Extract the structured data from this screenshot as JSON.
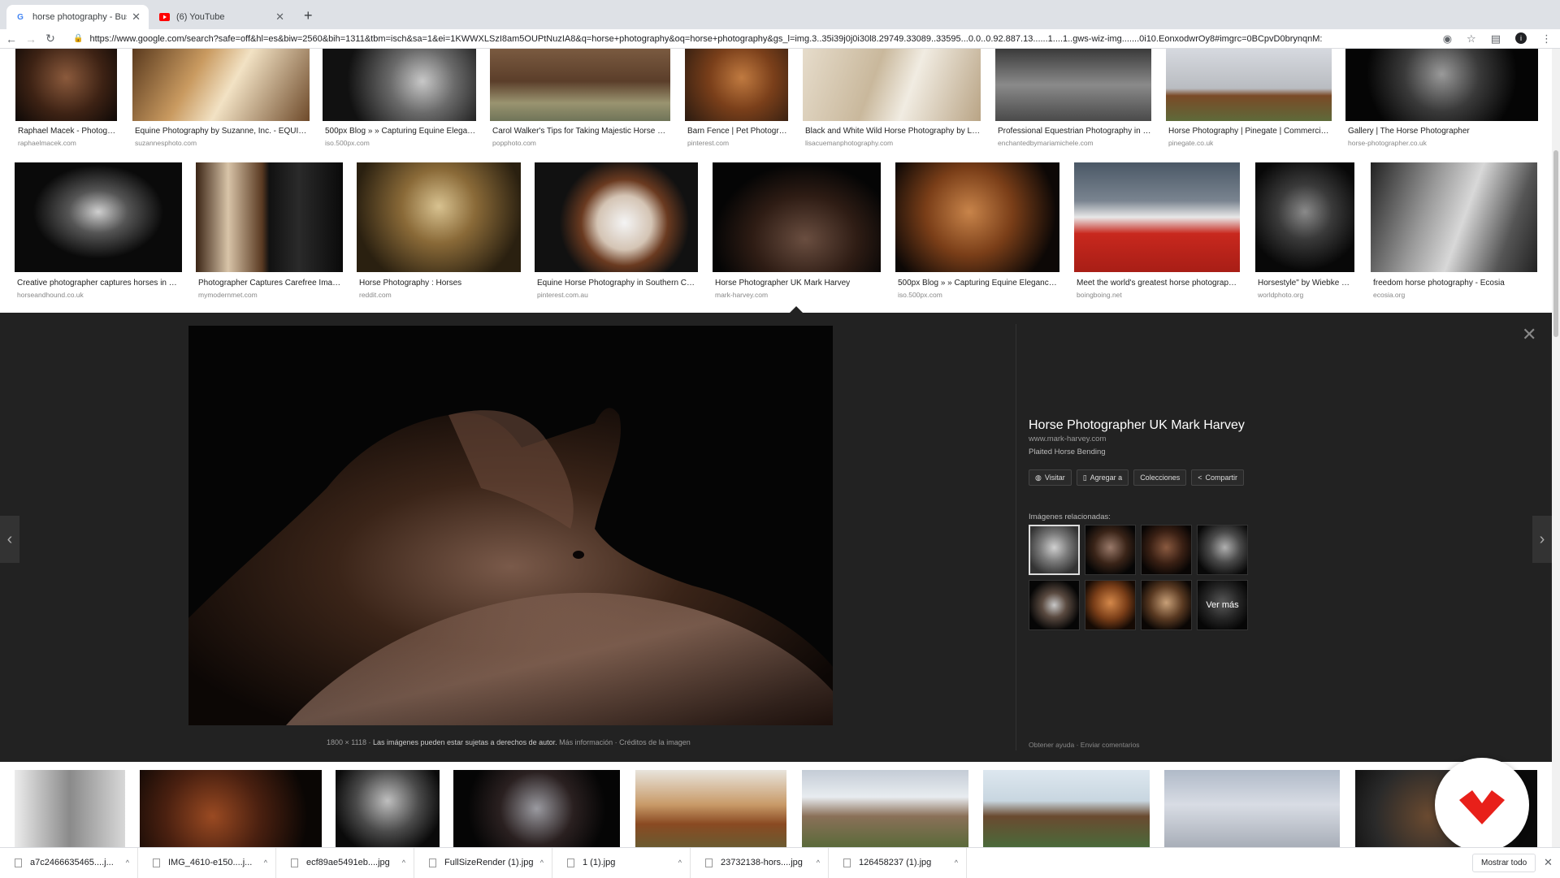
{
  "tabs": [
    {
      "label": "horse photography - Buscar co",
      "icon": "google-icon"
    },
    {
      "label": "(6) YouTube",
      "icon": "youtube-icon"
    }
  ],
  "toolbar": {
    "url": "https://www.google.com/search?safe=off&hl=es&biw=2560&bih=1311&tbm=isch&sa=1&ei=1KWWXLSzI8am5OUPtNuzIA8&q=horse+photography&oq=horse+photography&gs_l=img.3..35i39j0j0i30l8.29749.33089..33595...0.0..0.92.887.13......1....1..gws-wiz-img.......0i10.EonxodwrOy8#imgrc=0BCpvD0brynqnM:"
  },
  "row1": [
    {
      "title": "Raphael Macek - Photogra...",
      "domain": "raphaelmacek.com"
    },
    {
      "title": "Equine Photography by Suzanne, Inc. - EQUIN...",
      "domain": "suzannesphoto.com"
    },
    {
      "title": "500px Blog » » Capturing Equine Eleganc...",
      "domain": "iso.500px.com"
    },
    {
      "title": "Carol Walker's Tips for Taking Majestic Horse Pho...",
      "domain": "popphoto.com"
    },
    {
      "title": "Barn Fence | Pet Photogra...",
      "domain": "pinterest.com"
    },
    {
      "title": "Black and White Wild Horse Photography by Lisa...",
      "domain": "lisacuemanphotography.com"
    },
    {
      "title": "Professional Equestrian Photography in S...",
      "domain": "enchantedbymariamichele.com"
    },
    {
      "title": "Horse Photography | Pinegate | Commercial ...",
      "domain": "pinegate.co.uk"
    },
    {
      "title": "Gallery | The Horse Photographer",
      "domain": "horse-photographer.co.uk"
    }
  ],
  "row2": [
    {
      "title": "Creative photographer captures horses in ne...",
      "domain": "horseandhound.co.uk"
    },
    {
      "title": "Photographer Captures Carefree Image...",
      "domain": "mymodernmet.com"
    },
    {
      "title": "Horse Photography : Horses",
      "domain": "reddit.com"
    },
    {
      "title": "Equine Horse Photography in Southern Calif...",
      "domain": "pinterest.com.au"
    },
    {
      "title": "Horse Photographer UK Mark Harvey",
      "domain": "mark-harvey.com"
    },
    {
      "title": "500px Blog » » Capturing Equine Elegance: ...",
      "domain": "iso.500px.com"
    },
    {
      "title": "Meet the world's greatest horse photographer...",
      "domain": "boingboing.net"
    },
    {
      "title": "Horsestyle\" by Wiebke Ha...",
      "domain": "worldphoto.org"
    },
    {
      "title": "freedom horse photography - Ecosia",
      "domain": "ecosia.org"
    }
  ],
  "preview": {
    "title": "Horse Photographer UK Mark Harvey",
    "domain": "www.mark-harvey.com",
    "subtitle": "Plaited Horse Bending",
    "buttons": [
      "Visitar",
      "Agregar a",
      "Colecciones",
      "Compartir"
    ],
    "related_label": "Imágenes relacionadas:",
    "ver_mas": "Ver más",
    "dimensions": "1800 × 1118",
    "copyright": "Las imágenes pueden estar sujetas a derechos de autor.",
    "more_info": "Más información",
    "credits": "Créditos de la imagen",
    "help": "Obtener ayuda",
    "feedback": "Enviar comentarios"
  },
  "downloads": [
    "a7c2466635465....j...",
    "IMG_4610-e150....j...",
    "ecf89ae5491eb....jpg",
    "FullSizeRender (1).jpg",
    "1 (1).jpg",
    "23732138-hors....jpg",
    "126458237 (1).jpg"
  ],
  "shelf": {
    "show_all": "Mostrar todo"
  },
  "colors": {
    "tabstrip": "#dee1e6",
    "preview_bg": "#222222",
    "logo_red": "#e8201a"
  }
}
